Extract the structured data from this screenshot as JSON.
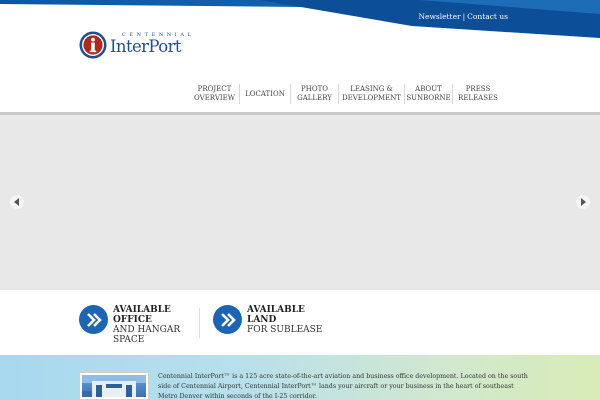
{
  "utility_links": {
    "newsletter": "Newsletter",
    "separator": "|",
    "contact": "Contact us"
  },
  "logo": {
    "small_text": "CENTENNIAL",
    "big_text": "InterPort",
    "mark_letter": "i"
  },
  "nav": {
    "items": [
      {
        "label": "PROJECT\nOVERVIEW"
      },
      {
        "label": "LOCATION"
      },
      {
        "label": "PHOTO\nGALLERY"
      },
      {
        "label": "LEASING &\nDEVELOPMENT"
      },
      {
        "label": "ABOUT\nSUNBORNE"
      },
      {
        "label": "PRESS\nRELEASES"
      }
    ]
  },
  "slider": {
    "prev_icon": "chevron-left-icon",
    "next_icon": "chevron-right-icon"
  },
  "features": {
    "office": {
      "line1": "AVAILABLE",
      "line2": "OFFICE",
      "line3": "AND HANGAR",
      "line4": "SPACE"
    },
    "land": {
      "line1": "AVAILABLE",
      "line2": "LAND",
      "line3": "FOR SUBLEASE"
    }
  },
  "intro": {
    "text": "Centennial InterPort™ is a 125 acre state-of-the-art aviation and business office development. Located on the south side of Centennial Airport, Centennial InterPort™ lands your aircraft or your business in the heart of southeast Metro Denver within seconds of the I-25 corridor."
  },
  "colors": {
    "brand_blue": "#1e64b4",
    "logo_blue": "#1e4f8c",
    "logo_red": "#b0291f"
  }
}
